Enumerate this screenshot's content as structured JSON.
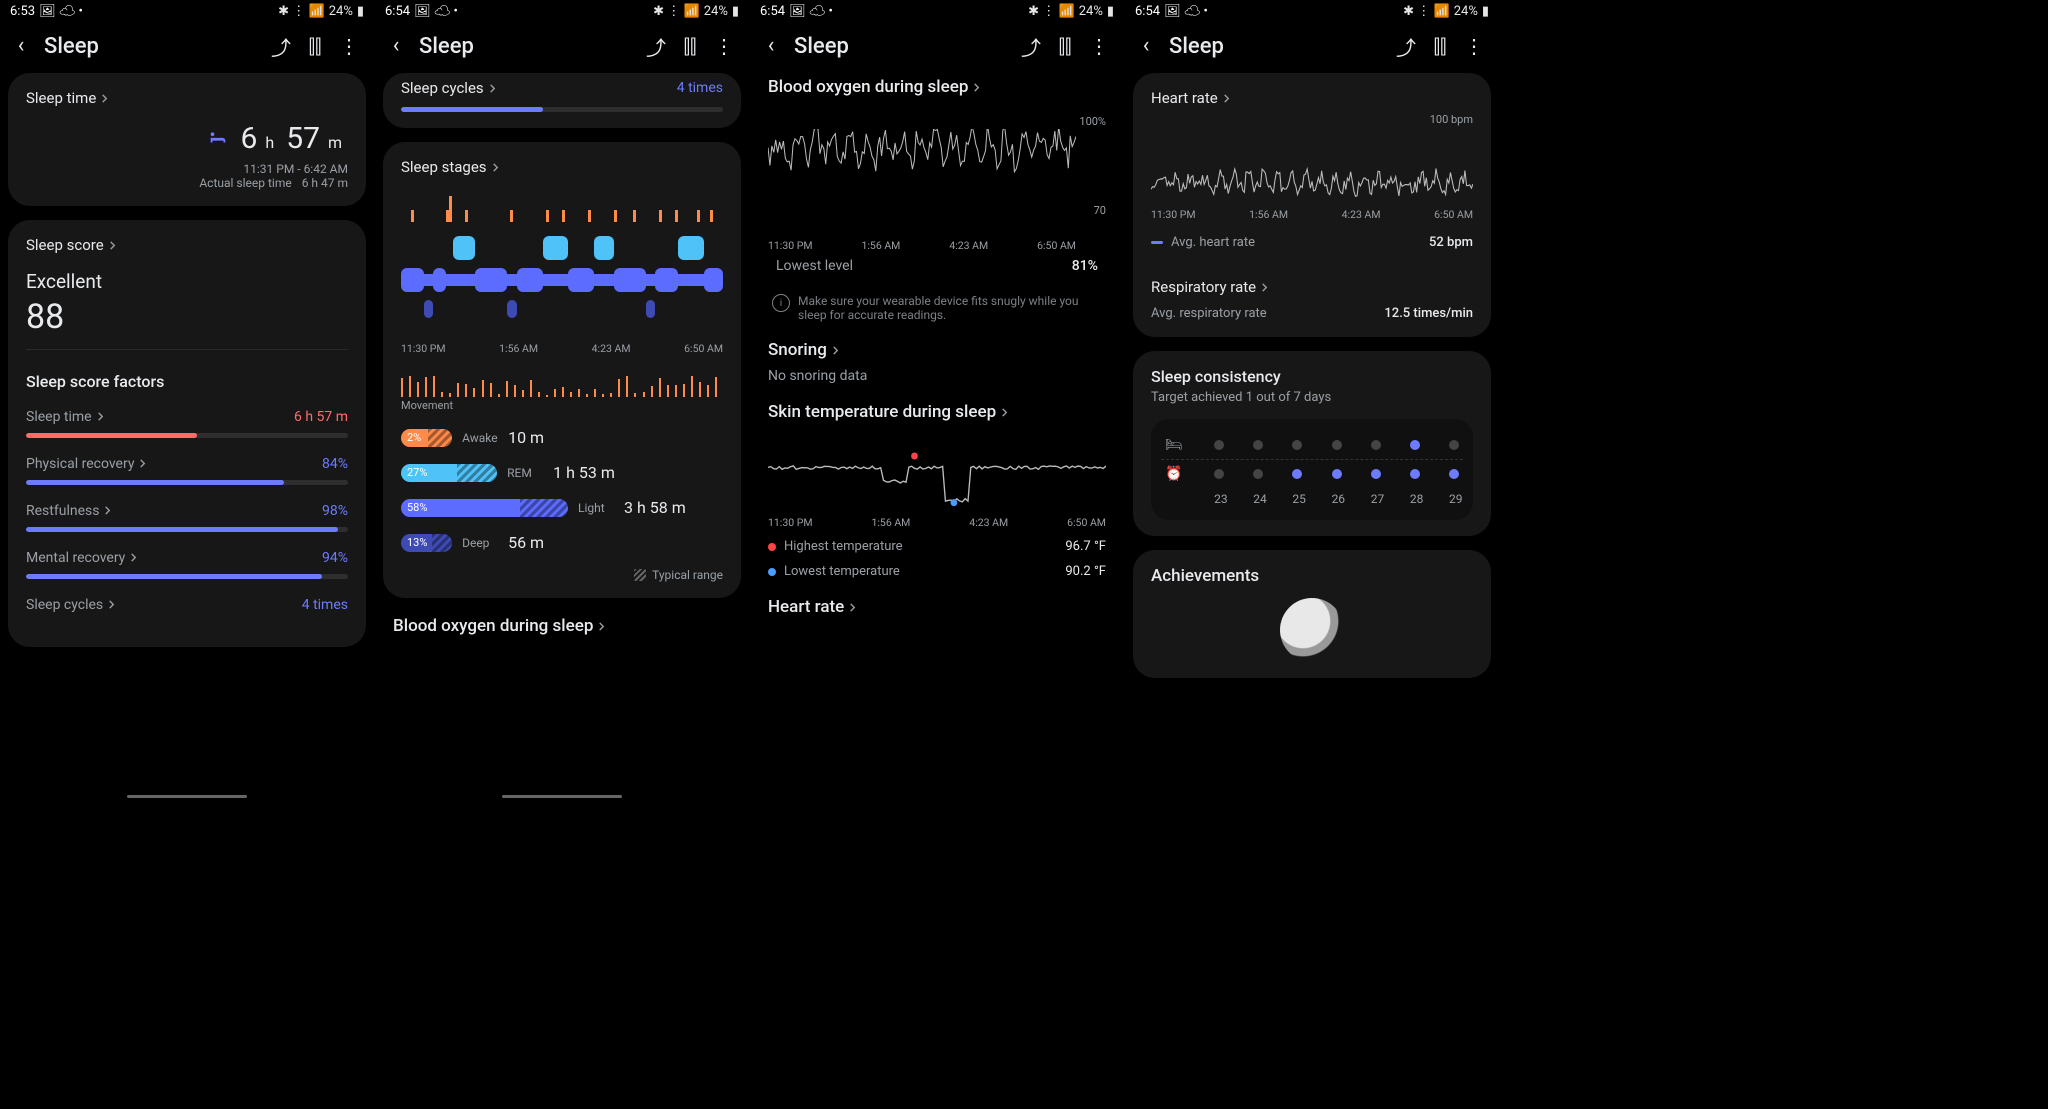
{
  "panes": [
    {
      "status": {
        "time": "6:53",
        "icons": "🖼 ☁ •",
        "right": "✱ 📶 🔋",
        "battery": "24%"
      },
      "title": "Sleep",
      "sleepTime": {
        "label": "Sleep time",
        "h": "6",
        "m": "57",
        "range": "11:31 PM - 6:42 AM",
        "actualLbl": "Actual sleep time",
        "actual": "6 h 47 m"
      },
      "sleepScore": {
        "label": "Sleep score",
        "word": "Excellent",
        "value": "88",
        "factorsTitle": "Sleep score factors"
      },
      "factors": [
        {
          "name": "Sleep time",
          "value": "6 h 57 m",
          "cls": "red",
          "pct": 53
        },
        {
          "name": "Physical recovery",
          "value": "84%",
          "cls": "blue",
          "pct": 80
        },
        {
          "name": "Restfulness",
          "value": "98%",
          "cls": "blue",
          "pct": 97
        },
        {
          "name": "Mental recovery",
          "value": "94%",
          "cls": "blue",
          "pct": 92
        },
        {
          "name": "Sleep cycles",
          "value": "4 times",
          "cls": "blue",
          "pct": 0,
          "nobar": true
        }
      ]
    },
    {
      "status": {
        "time": "6:54",
        "icons": "🖼 ☁ •",
        "battery": "24%"
      },
      "title": "Sleep",
      "cycles": {
        "label": "Sleep cycles",
        "value": "4 times",
        "pct": 44
      },
      "stages": {
        "label": "Sleep stages",
        "axis": [
          "11:30 PM",
          "1:56 AM",
          "4:23 AM",
          "6:50 AM"
        ],
        "mvLabel": "Movement"
      },
      "stageRows": [
        {
          "pct": "2%",
          "name": "Awake",
          "dur": "10 m",
          "w": 14,
          "color": "#ff8a4a",
          "hatch": 6
        },
        {
          "pct": "27%",
          "name": "REM",
          "dur": "1 h 53 m",
          "w": 28,
          "color": "#4fc3f7",
          "hatch": 10
        },
        {
          "pct": "58%",
          "name": "Light",
          "dur": "3 h 58 m",
          "w": 50,
          "color": "#5b6cff",
          "hatch": 12
        },
        {
          "pct": "13%",
          "name": "Deep",
          "dur": "56 m",
          "w": 14,
          "color": "#3f4bb5",
          "hatch": 5
        }
      ],
      "typical": "Typical range",
      "bo": {
        "label": "Blood oxygen during sleep"
      }
    },
    {
      "status": {
        "time": "6:54",
        "icons": "🖼 ☁ •",
        "battery": "24%"
      },
      "title": "Sleep",
      "bo": {
        "label": "Blood oxygen during sleep",
        "yTop": "100%",
        "yBot": "70",
        "axis": [
          "11:30 PM",
          "1:56 AM",
          "4:23 AM",
          "6:50 AM"
        ],
        "lowestLbl": "Lowest level",
        "lowest": "81%",
        "tip": "Make sure your wearable device fits snugly while you sleep for accurate readings."
      },
      "snoring": {
        "label": "Snoring",
        "none": "No snoring data"
      },
      "temp": {
        "label": "Skin temperature during sleep",
        "axis": [
          "11:30 PM",
          "1:56 AM",
          "4:23 AM",
          "6:50 AM"
        ],
        "hiLbl": "Highest temperature",
        "hi": "96.7 °F",
        "loLbl": "Lowest temperature",
        "lo": "90.2 °F"
      },
      "hr": {
        "label": "Heart rate"
      }
    },
    {
      "status": {
        "time": "6:54",
        "icons": "🖼 ☁ •",
        "battery": "24%"
      },
      "title": "Sleep",
      "hr": {
        "label": "Heart rate",
        "yTop": "100 bpm",
        "axis": [
          "11:30 PM",
          "1:56 AM",
          "4:23 AM",
          "6:50 AM"
        ],
        "avgLbl": "Avg. heart rate",
        "avg": "52 bpm"
      },
      "resp": {
        "label": "Respiratory rate",
        "avgLbl": "Avg. respiratory rate",
        "avg": "12.5 times/min"
      },
      "consist": {
        "label": "Sleep consistency",
        "target": "Target achieved 1 out of 7 days",
        "dates": [
          "23",
          "24",
          "25",
          "26",
          "27",
          "28",
          "29"
        ],
        "row1": [
          0,
          0,
          0,
          0,
          0,
          1,
          0
        ],
        "row2": [
          0,
          0,
          1,
          1,
          1,
          1,
          1
        ]
      },
      "ach": {
        "label": "Achievements"
      }
    }
  ],
  "chart_data": {
    "sleep_stages": {
      "type": "area",
      "title": "Sleep stages",
      "x_range": [
        "11:30 PM",
        "6:50 AM"
      ],
      "segments": [
        {
          "stage": "Light",
          "start": 0,
          "end": 7
        },
        {
          "stage": "Deep",
          "start": 7,
          "end": 10
        },
        {
          "stage": "Light",
          "start": 10,
          "end": 14
        },
        {
          "stage": "Awake",
          "start": 14,
          "end": 16
        },
        {
          "stage": "REM",
          "start": 16,
          "end": 23
        },
        {
          "stage": "Light",
          "start": 23,
          "end": 33
        },
        {
          "stage": "Deep",
          "start": 33,
          "end": 36
        },
        {
          "stage": "Light",
          "start": 36,
          "end": 44
        },
        {
          "stage": "REM",
          "start": 44,
          "end": 52
        },
        {
          "stage": "Light",
          "start": 52,
          "end": 60
        },
        {
          "stage": "REM",
          "start": 60,
          "end": 66
        },
        {
          "stage": "Light",
          "start": 66,
          "end": 76
        },
        {
          "stage": "Deep",
          "start": 76,
          "end": 79
        },
        {
          "stage": "Light",
          "start": 79,
          "end": 86
        },
        {
          "stage": "REM",
          "start": 86,
          "end": 94
        },
        {
          "stage": "Light",
          "start": 94,
          "end": 100
        }
      ],
      "summary": {
        "Awake": {
          "pct": 2,
          "minutes": 10
        },
        "REM": {
          "pct": 27,
          "minutes": 113
        },
        "Light": {
          "pct": 58,
          "minutes": 238
        },
        "Deep": {
          "pct": 13,
          "minutes": 56
        }
      }
    },
    "blood_oxygen": {
      "type": "line",
      "ylabel": "%",
      "ylim": [
        70,
        100
      ],
      "x_ticks": [
        "11:30 PM",
        "1:56 AM",
        "4:23 AM",
        "6:50 AM"
      ],
      "lowest": 81
    },
    "skin_temperature": {
      "type": "line",
      "ylabel": "°F",
      "x_ticks": [
        "11:30 PM",
        "1:56 AM",
        "4:23 AM",
        "6:50 AM"
      ],
      "highest": 96.7,
      "lowest": 90.2
    },
    "heart_rate": {
      "type": "line",
      "ylabel": "bpm",
      "ylim": [
        40,
        100
      ],
      "x_ticks": [
        "11:30 PM",
        "1:56 AM",
        "4:23 AM",
        "6:50 AM"
      ],
      "avg": 52
    },
    "respiratory_rate": {
      "avg": 12.5,
      "unit": "times/min"
    },
    "sleep_consistency": {
      "type": "table",
      "dates": [
        23,
        24,
        25,
        26,
        27,
        28,
        29
      ],
      "bedtime_met": [
        0,
        0,
        0,
        0,
        0,
        1,
        0
      ],
      "wakeup_met": [
        0,
        0,
        1,
        1,
        1,
        1,
        1
      ],
      "target_met_days": 1,
      "target_days": 7
    }
  }
}
